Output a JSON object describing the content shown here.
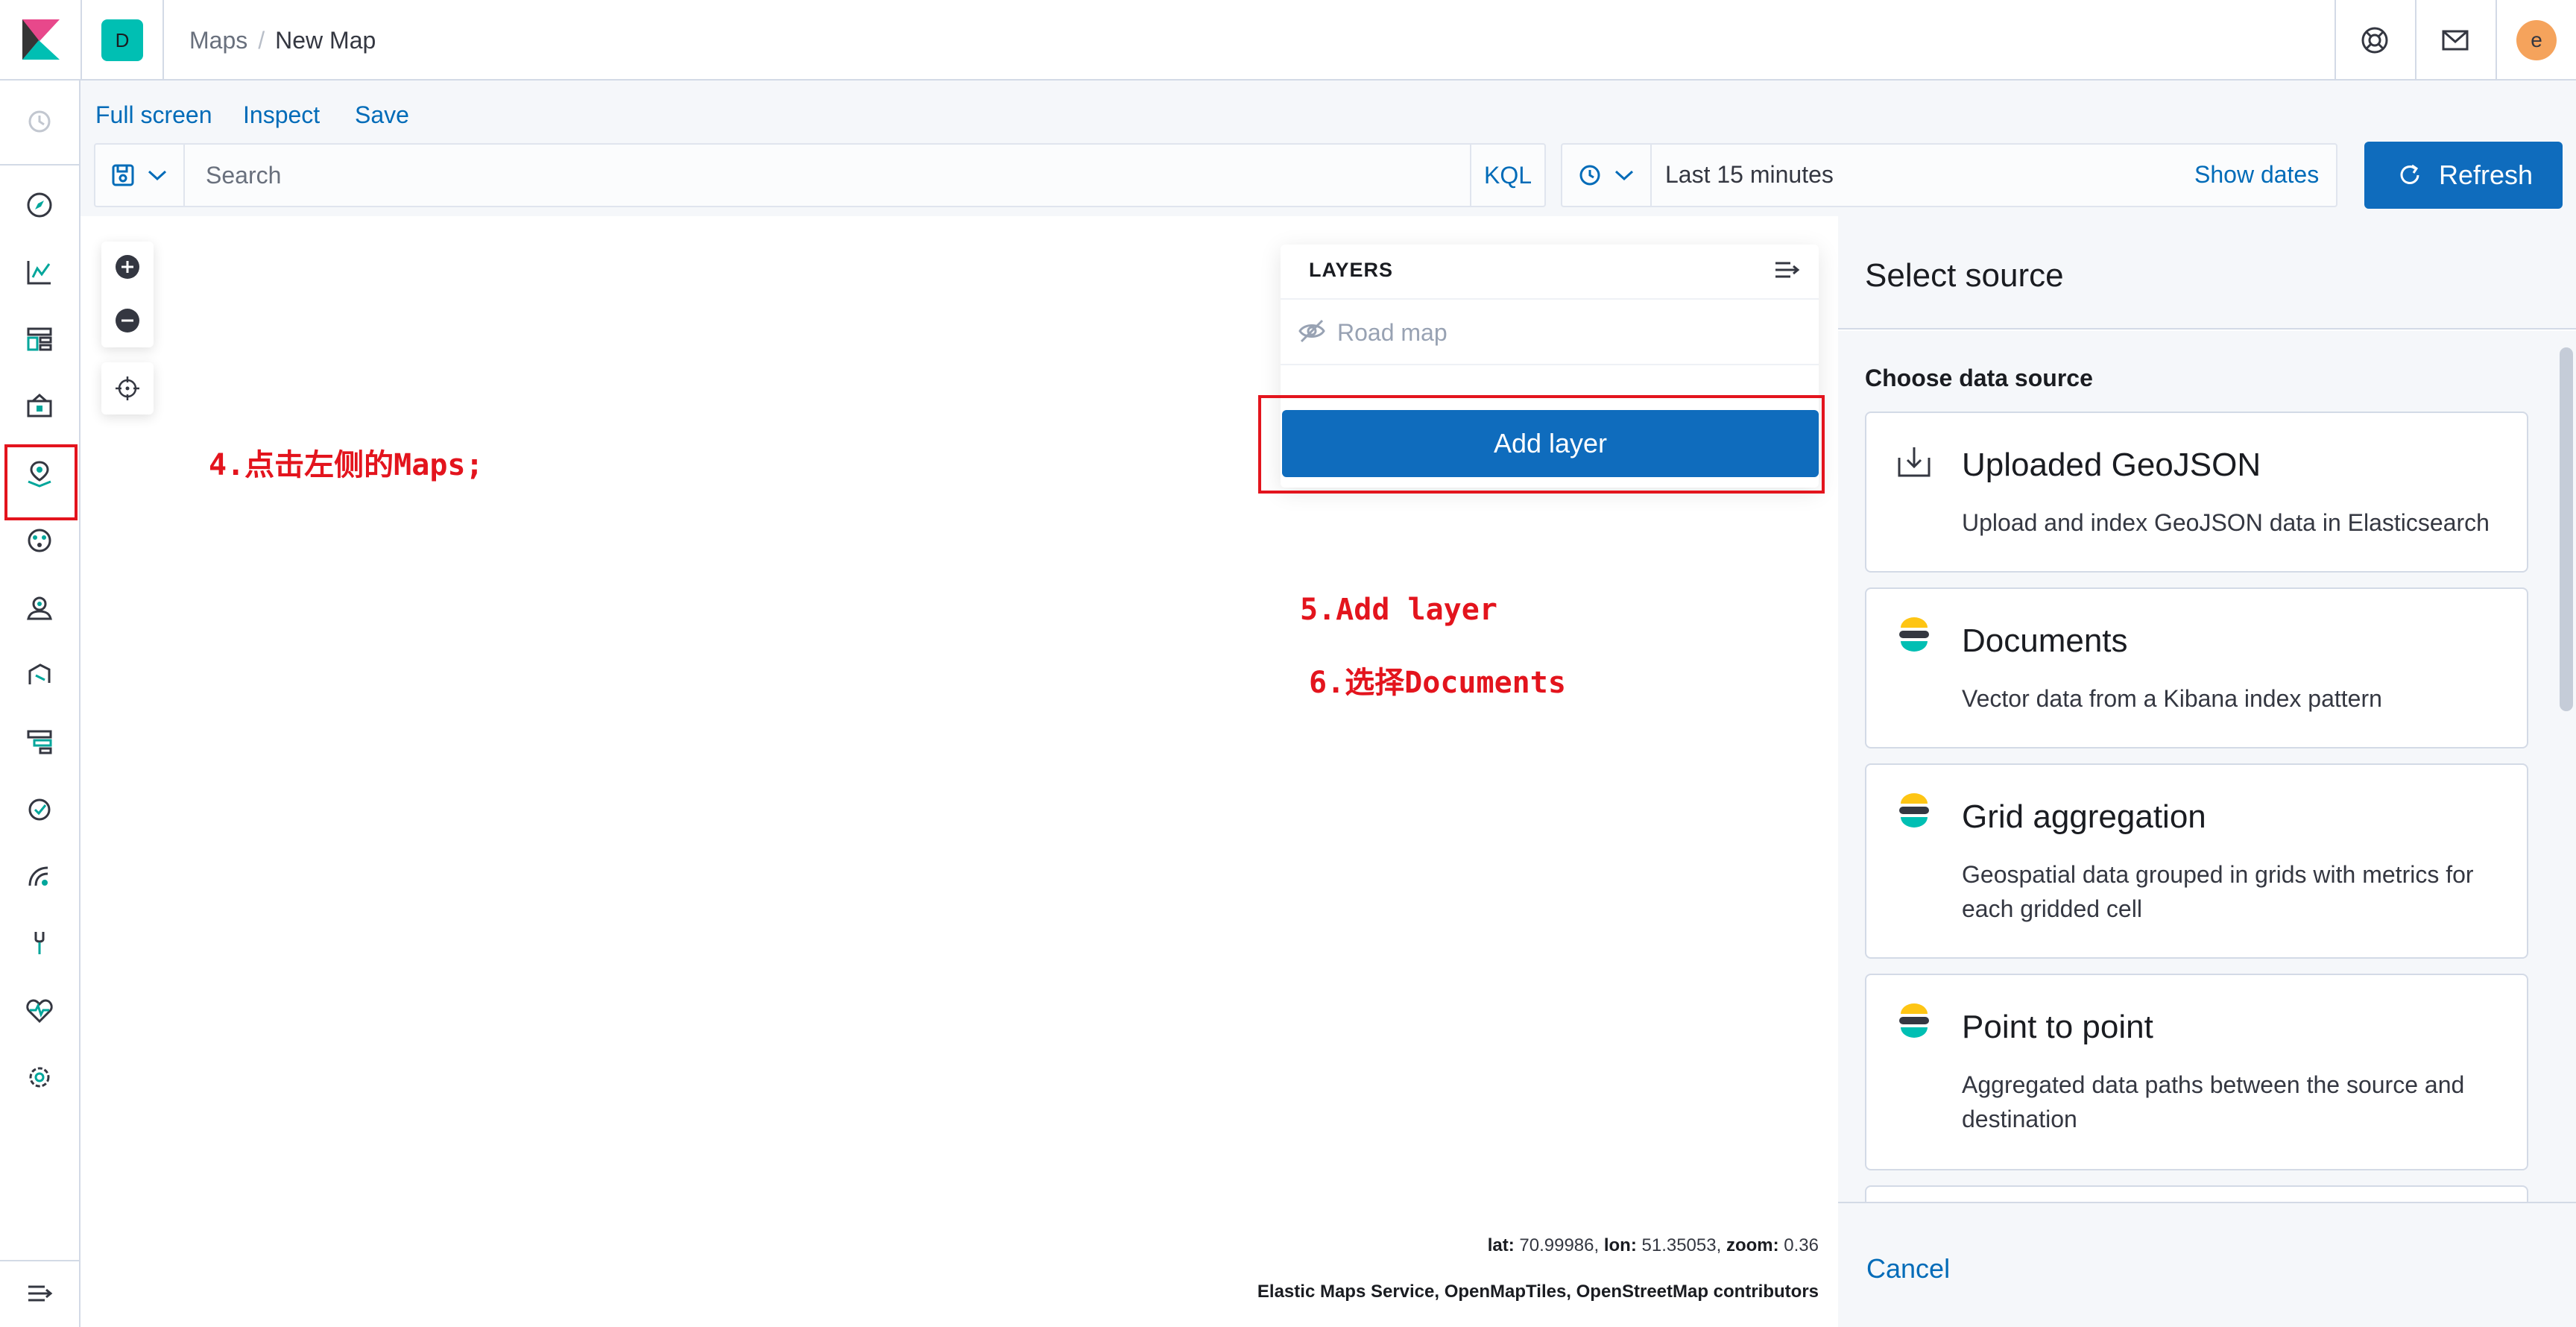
{
  "colors": {
    "accent": "#006bb8",
    "button_primary": "#0f6cbd",
    "annotation_red": "#e3141d",
    "space_avatar": "#00bfb3",
    "user_avatar": "#f5a35c"
  },
  "header": {
    "space_initial": "D",
    "breadcrumb": [
      {
        "label": "Maps"
      },
      {
        "label": "New Map"
      }
    ],
    "user_initial": "e",
    "icons": [
      "help-icon",
      "newsfeed-icon"
    ]
  },
  "sidenav": {
    "items": [
      {
        "icon": "recent-clock-icon"
      },
      {
        "icon": "discover-compass-icon"
      },
      {
        "icon": "visualize-icon"
      },
      {
        "icon": "dashboard-icon"
      },
      {
        "icon": "canvas-icon"
      },
      {
        "icon": "maps-icon",
        "active": true
      },
      {
        "icon": "ml-icon"
      },
      {
        "icon": "infrastructure-icon"
      },
      {
        "icon": "logs-icon"
      },
      {
        "icon": "apm-icon"
      },
      {
        "icon": "uptime-icon"
      },
      {
        "icon": "siem-icon"
      },
      {
        "icon": "dev-tools-icon"
      },
      {
        "icon": "monitoring-icon"
      },
      {
        "icon": "management-gear-icon"
      },
      {
        "icon": "collapse-nav-icon"
      }
    ]
  },
  "topnav": {
    "links": [
      "Full screen",
      "Inspect",
      "Save"
    ]
  },
  "query": {
    "placeholder": "Search",
    "language": "KQL"
  },
  "time": {
    "range": "Last 15 minutes",
    "show_dates": "Show dates",
    "refresh": "Refresh"
  },
  "layers": {
    "title": "LAYERS",
    "items": [
      {
        "label": "Road map",
        "visible": false
      }
    ],
    "add_layer": "Add layer"
  },
  "annotations": {
    "step4": "4.点击左侧的Maps;",
    "step5": "5.Add layer",
    "step6": "6.选择Documents"
  },
  "map_footer": {
    "lat_label": "lat:",
    "lat_value": "70.99986,",
    "lon_label": "lon:",
    "lon_value": "51.35053,",
    "zoom_label": "zoom:",
    "zoom_value": "0.36",
    "attribution": "Elastic Maps Service, OpenMapTiles, OpenStreetMap contributors"
  },
  "flyout": {
    "title": "Select source",
    "section": "Choose data source",
    "sources": [
      {
        "title": "Uploaded GeoJSON",
        "description": "Upload and index GeoJSON data in Elasticsearch",
        "icon": "import-icon"
      },
      {
        "title": "Documents",
        "description": "Vector data from a Kibana index pattern",
        "icon": "elastic-logo-icon"
      },
      {
        "title": "Grid aggregation",
        "description": "Geospatial data grouped in grids with metrics for each gridded cell",
        "icon": "elastic-logo-icon"
      },
      {
        "title": "Point to point",
        "description": "Aggregated data paths between the source and destination",
        "icon": "elastic-logo-icon"
      }
    ],
    "cancel": "Cancel"
  }
}
